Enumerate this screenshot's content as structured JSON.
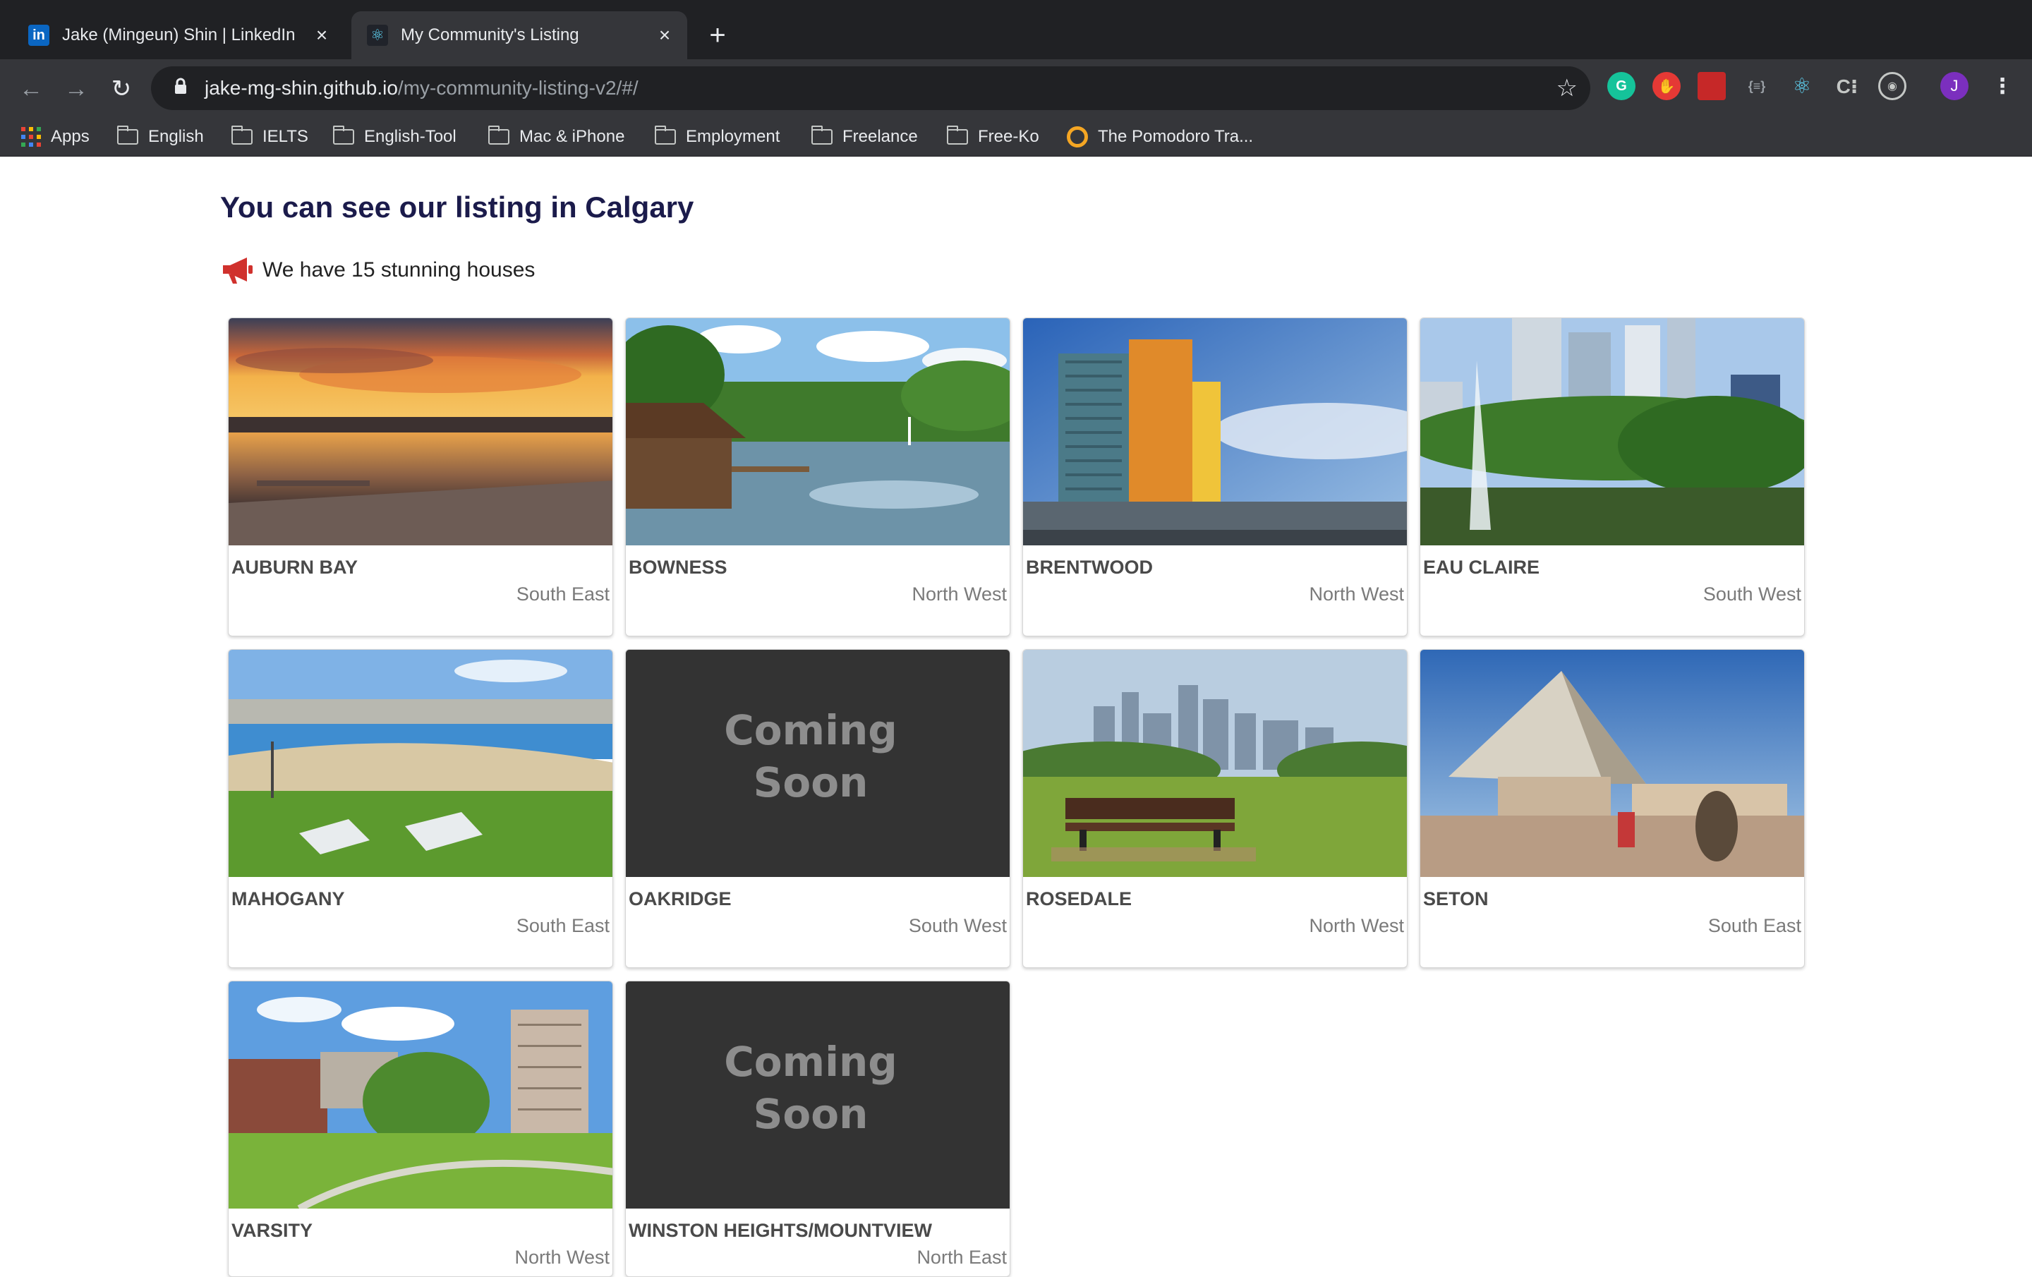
{
  "browser": {
    "tabs": [
      {
        "title": "Jake (Mingeun) Shin | LinkedIn",
        "favicon": "linkedin-icon",
        "active": false
      },
      {
        "title": "My Community's Listing",
        "favicon": "react-icon",
        "active": true
      }
    ],
    "url_host": "jake-mg-shin.github.io",
    "url_path": "/my-community-listing-v2/#/",
    "profile_initial": "J",
    "bookmarks": [
      {
        "label": "Apps",
        "icon": "apps-grid-icon"
      },
      {
        "label": "English",
        "icon": "folder-icon"
      },
      {
        "label": "IELTS",
        "icon": "folder-icon"
      },
      {
        "label": "English-Tool",
        "icon": "folder-icon"
      },
      {
        "label": "Mac & iPhone",
        "icon": "folder-icon"
      },
      {
        "label": "Employment",
        "icon": "folder-icon"
      },
      {
        "label": "Freelance",
        "icon": "folder-icon"
      },
      {
        "label": "Free-Ko",
        "icon": "folder-icon"
      },
      {
        "label": "The Pomodoro Tra...",
        "icon": "pomodoro-icon"
      }
    ]
  },
  "page": {
    "title": "You can see our listing in Calgary",
    "subtitle": "We have 15 stunning houses"
  },
  "listings": [
    {
      "name": "AUBURN BAY",
      "region": "South East",
      "image": "lake-sunset"
    },
    {
      "name": "BOWNESS",
      "region": "North West",
      "image": "park-lagoon"
    },
    {
      "name": "BRENTWOOD",
      "region": "North West",
      "image": "highrise-tower"
    },
    {
      "name": "EAU CLAIRE",
      "region": "South West",
      "image": "downtown-fountain"
    },
    {
      "name": "MAHOGANY",
      "region": "South East",
      "image": "beach-park"
    },
    {
      "name": "OAKRIDGE",
      "region": "South West",
      "image": "coming-soon"
    },
    {
      "name": "ROSEDALE",
      "region": "North West",
      "image": "skyline-bench"
    },
    {
      "name": "SETON",
      "region": "South East",
      "image": "pavilion"
    },
    {
      "name": "VARSITY",
      "region": "North West",
      "image": "apartments-courtyard"
    },
    {
      "name": "WINSTON HEIGHTS/MOUNTVIEW",
      "region": "North East",
      "image": "coming-soon"
    }
  ],
  "coming_soon": {
    "line1": "Coming",
    "line2": "Soon"
  },
  "colors": {
    "heading": "#1b1b4b",
    "chrome_dark": "#202124",
    "chrome_toolbar": "#35363a",
    "megaphone": "#d0312d",
    "profile": "#7b2fbe"
  }
}
